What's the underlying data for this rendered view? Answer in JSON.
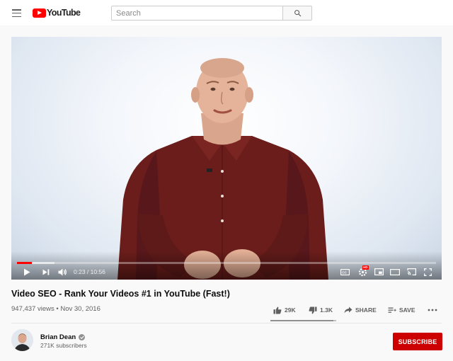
{
  "header": {
    "logo_text": "YouTube",
    "search": {
      "placeholder": "Search",
      "value": ""
    }
  },
  "player": {
    "time_current": "0:23",
    "time_total": "10:56",
    "time_display": "0:23 / 10:56",
    "progress_played_fraction": 0.035,
    "progress_loaded_fraction": 0.09,
    "controls": [
      "play-icon",
      "next-icon",
      "volume-icon",
      "captions-icon",
      "settings-icon",
      "miniplayer-icon",
      "theater-icon",
      "cast-icon",
      "fullscreen-icon"
    ],
    "hd_badge": "HD"
  },
  "video": {
    "title": "Video SEO - Rank Your Videos #1 in YouTube (Fast!)",
    "views": "947,437 views",
    "date": "Nov 30, 2016",
    "meta_text": "947,437 views • Nov 30, 2016",
    "likes": "29K",
    "dislikes": "1.3K",
    "like_fraction": 0.957,
    "share_label": "SHARE",
    "save_label": "SAVE"
  },
  "channel": {
    "name": "Brian Dean",
    "subscribers": "271K subscribers",
    "subscribe_label": "SUBSCRIBE"
  },
  "colors": {
    "brand_red": "#ff0000",
    "subscribe_red": "#cc0000",
    "shirt": "#6e1f1c"
  }
}
